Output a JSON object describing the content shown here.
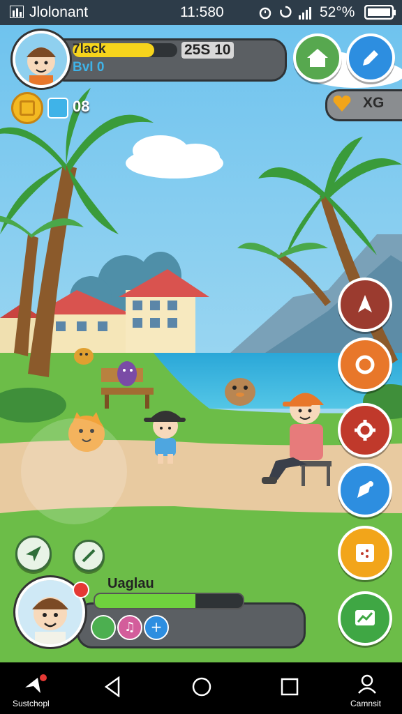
{
  "status_bar": {
    "app_name": "Jlolonant",
    "time": "11:580",
    "battery": "52°%"
  },
  "player": {
    "name": "7lack",
    "score": "25S 10",
    "level": "Bvl 0",
    "xp_fill": 0.78
  },
  "currencies": {
    "coin_count": "08",
    "gem_label": "XG"
  },
  "companion": {
    "name": "Uaglau",
    "health_fill": 0.68
  },
  "side_buttons": [
    {
      "icon": "rocket-icon",
      "color": "#9b3b2f"
    },
    {
      "icon": "ring-icon",
      "color": "#e8772a"
    },
    {
      "icon": "settings-gear-icon",
      "color": "#c0392b"
    },
    {
      "icon": "map-pin-icon",
      "color": "#2d8ee0"
    },
    {
      "icon": "inventory-icon",
      "color": "#f2a51a"
    },
    {
      "icon": "stats-chart-icon",
      "color": "#3fa744"
    }
  ],
  "nav": {
    "left_label": "Sustchopl",
    "right_label": "Camnsit"
  },
  "colors": {
    "sky": "#7ec9ef",
    "grass": "#6cbd48",
    "sand": "#e8caa0",
    "xp_bar": "#f6d41c",
    "health_bar": "#6fd23d"
  }
}
